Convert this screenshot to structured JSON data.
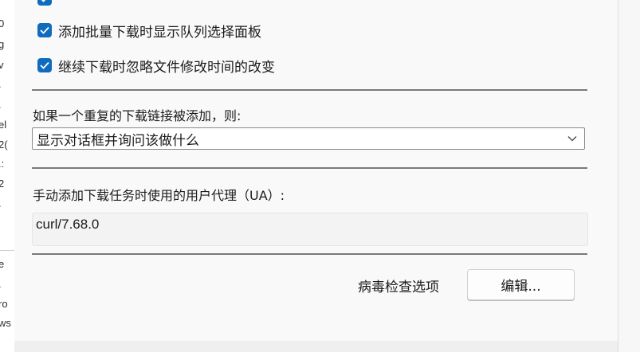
{
  "checkboxes": [
    {
      "label": "",
      "checked": true
    },
    {
      "label": "添加批量下载时显示队列选择面板",
      "checked": true
    },
    {
      "label": "继续下载时忽略文件修改时间的改变",
      "checked": true
    }
  ],
  "duplicate": {
    "label": "如果一个重复的下载链接被添加，则:",
    "selected": "显示对话框并询问该做什么"
  },
  "user_agent": {
    "label": "手动添加下载任务时使用的用户代理（UA）:",
    "value": "curl/7.68.0"
  },
  "antivirus": {
    "label": "病毒检查选项",
    "button": "编辑..."
  },
  "background_fragments": [
    "0",
    "g",
    "v",
    ".",
    ".",
    "el",
    "2(",
    ".:",
    "2",
    ".",
    "e",
    ".",
    "ro",
    "ws"
  ],
  "colors": {
    "accent": "#0f6cbd",
    "separator": "#7a7a7a"
  }
}
